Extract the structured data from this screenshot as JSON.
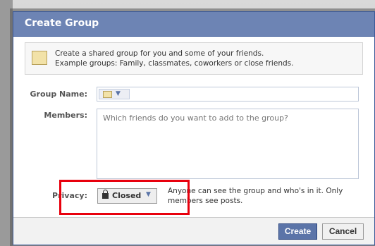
{
  "dialog": {
    "title": "Create Group",
    "intro_line1": "Create a shared group for you and some of your friends.",
    "intro_line2": "Example groups: Family, classmates, coworkers or close friends."
  },
  "form": {
    "group_name_label": "Group Name:",
    "members_label": "Members:",
    "members_placeholder": "Which friends do you want to add to the group?",
    "privacy_label": "Privacy:",
    "privacy_value": "Closed",
    "privacy_desc_line1": "Anyone can see the group and who's in it. Only",
    "privacy_desc_line2": "members see posts."
  },
  "footer": {
    "create_label": "Create",
    "cancel_label": "Cancel"
  },
  "icons": {
    "group": "group-icon",
    "group_small": "group-picker-icon",
    "chevron": "chevron-down-icon",
    "lock": "lock-icon"
  },
  "colors": {
    "title_bar": "#6d84b4",
    "create_button": "#5b74a8",
    "highlight": "#e8000d"
  }
}
